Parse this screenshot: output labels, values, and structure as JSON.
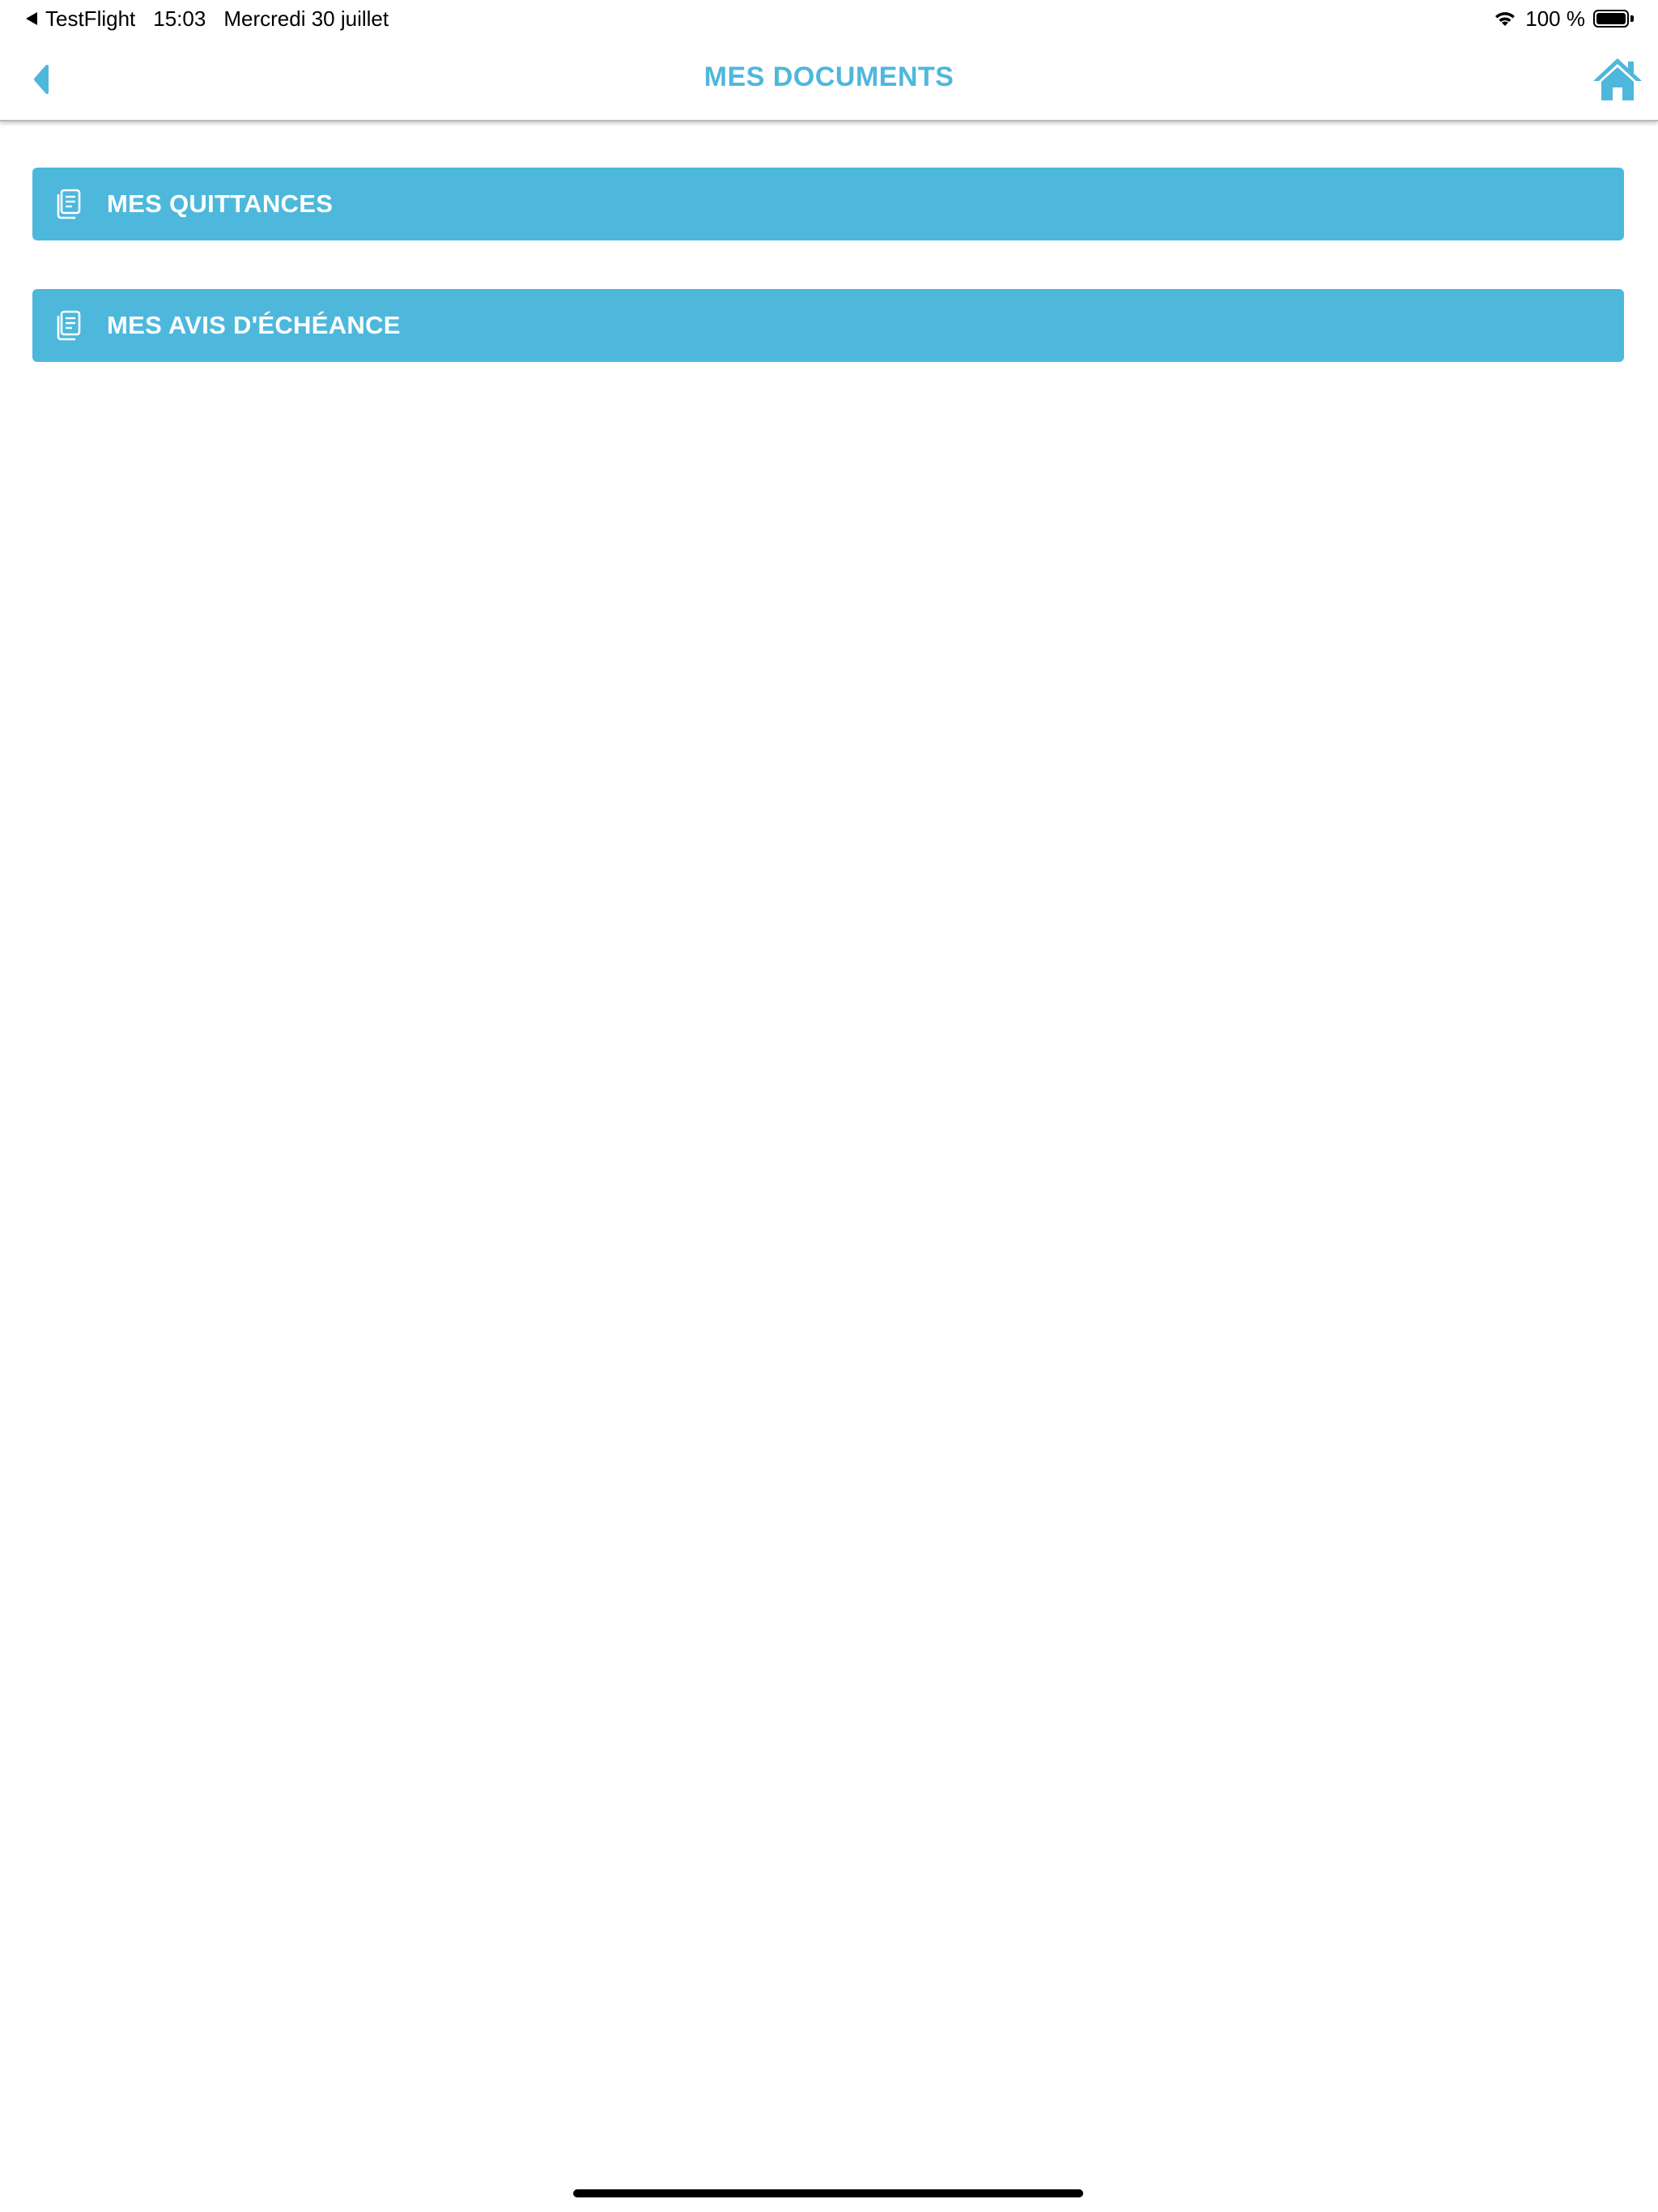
{
  "status_bar": {
    "back_app": "TestFlight",
    "time": "15:03",
    "date": "Mercredi 30 juillet",
    "battery_percent": "100 %",
    "battery_level": 1.0
  },
  "nav": {
    "title": "MES DOCUMENTS",
    "back_icon": "chevron-left-icon",
    "home_icon": "home-icon"
  },
  "menu": {
    "items": [
      {
        "label": "MES QUITTANCES",
        "icon": "documents-icon"
      },
      {
        "label": "MES AVIS D'ÉCHÉANCE",
        "icon": "documents-icon"
      }
    ]
  },
  "colors": {
    "accent": "#4db8dc",
    "title": "#4fb7db",
    "button_text": "#ffffff"
  }
}
